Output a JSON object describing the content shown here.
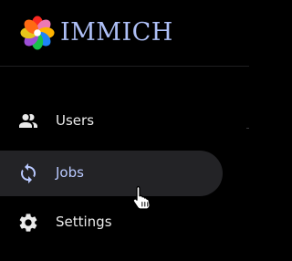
{
  "app": {
    "name": "IMMICH",
    "logo_icon": "immich-flower-logo-icon"
  },
  "colors": {
    "background": "#000000",
    "brand_text": "#aebff6",
    "active_bg": "#232326",
    "active_text": "#b9c9ff",
    "text": "#eaeaea"
  },
  "sidebar": {
    "items": [
      {
        "label": "Users",
        "icon": "users-icon",
        "active": false
      },
      {
        "label": "Jobs",
        "icon": "sync-icon",
        "active": true
      },
      {
        "label": "Settings",
        "icon": "gear-icon",
        "active": false
      }
    ]
  },
  "cursor": {
    "icon": "hand-pointer-icon"
  }
}
